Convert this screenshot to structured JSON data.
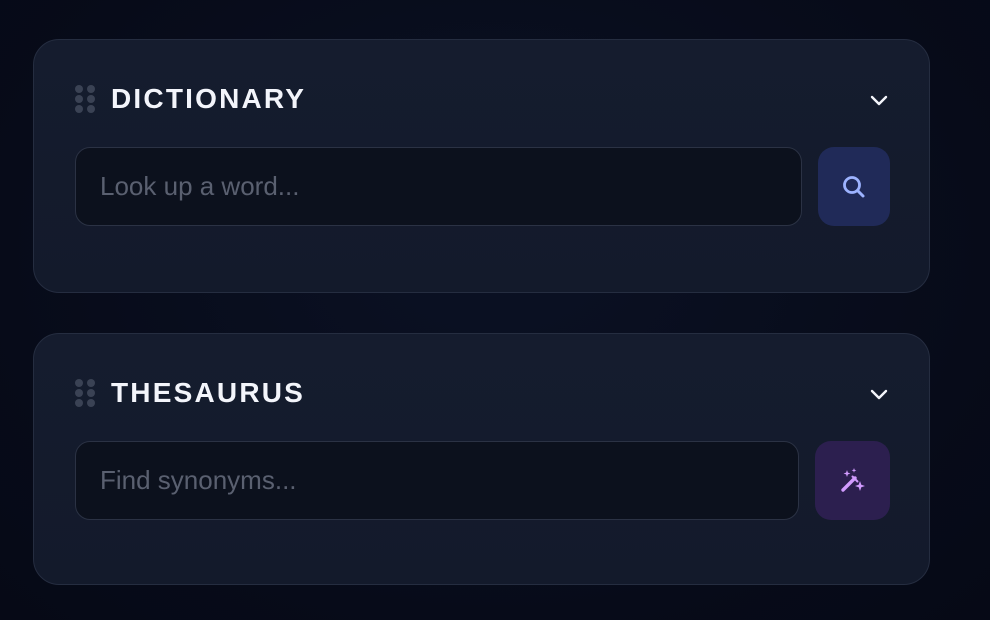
{
  "colors": {
    "page_background": "#070b19",
    "card_background": "#151c2e",
    "card_border": "#252d40",
    "title_text": "#f3f5fb",
    "placeholder_text": "#5a6070",
    "search_button_bg": "#202a58",
    "search_icon": "#9db3ff",
    "magic_button_bg": "#2c1f4f",
    "magic_icon": "#d29bff"
  },
  "dictionary": {
    "title": "DICTIONARY",
    "input_value": "",
    "placeholder": "Look up a word...",
    "action_icon": "search-icon",
    "drag_icon": "drag-handle-icon",
    "toggle_icon": "chevron-down-icon"
  },
  "thesaurus": {
    "title": "THESAURUS",
    "input_value": "",
    "placeholder": "Find synonyms...",
    "action_icon": "magic-wand-icon",
    "drag_icon": "drag-handle-icon",
    "toggle_icon": "chevron-down-icon"
  }
}
